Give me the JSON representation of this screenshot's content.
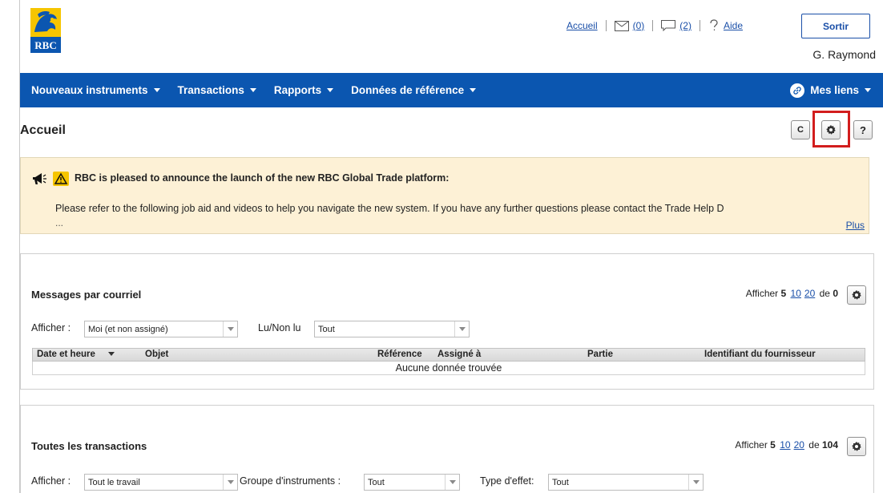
{
  "header": {
    "logo_text": "RBC",
    "links": {
      "home": "Accueil",
      "mail_count": "(0)",
      "chat_count": "(2)",
      "help": "Aide"
    },
    "logout_label": "Sortir",
    "user_name": "G. Raymond"
  },
  "nav": {
    "items": [
      {
        "label": "Nouveaux instruments"
      },
      {
        "label": "Transactions"
      },
      {
        "label": "Rapports"
      },
      {
        "label": "Données de référence"
      }
    ],
    "my_links": "Mes liens"
  },
  "page": {
    "title": "Accueil",
    "refresh_symbol": "C",
    "help_symbol": "?"
  },
  "announcement": {
    "title": "RBC is pleased to announce the launch of the new RBC Global Trade platform:",
    "body": "Please refer to the following job aid and videos to help you navigate the new system. If you have any further questions please contact the Trade Help D",
    "ellipsis": "...",
    "more_link": "Plus"
  },
  "email_panel": {
    "title": "Messages par courriel",
    "pager_prefix": "Afficher",
    "pager_current": "5",
    "pager_opt1": "10",
    "pager_opt2": "20",
    "pager_of": "de",
    "pager_total": "0",
    "filter_show_label": "Afficher :",
    "filter_show_value": "Moi (et non assigné)",
    "filter_read_label": "Lu/Non lu",
    "filter_read_value": "Tout",
    "columns": {
      "datetime": "Date et heure",
      "subject": "Objet",
      "reference": "Référence",
      "assigned": "Assigné à",
      "party": "Partie",
      "supplier_id": "Identifiant du fournisseur"
    },
    "empty_message": "Aucune donnée trouvée"
  },
  "transactions_panel": {
    "title": "Toutes les transactions",
    "pager_prefix": "Afficher",
    "pager_current": "5",
    "pager_opt1": "10",
    "pager_opt2": "20",
    "pager_of": "de",
    "pager_total": "104",
    "filter_show_label": "Afficher :",
    "filter_show_value": "Tout le travail",
    "filter_group_label": "Groupe d'instruments :",
    "filter_group_value": "Tout",
    "filter_type_label": "Type d'effet:",
    "filter_type_value": "Tout"
  },
  "colors": {
    "nav_bg": "#0b56b0",
    "link": "#1a4fa8",
    "announcement_bg": "#fdf1d6",
    "highlight": "#d21d1d"
  },
  "icons": [
    "rbc-lion-logo-icon",
    "mail-icon",
    "chat-icon",
    "help-icon",
    "link-icon",
    "refresh-icon",
    "gear-icon",
    "megaphone-icon",
    "warning-icon",
    "chevron-down-icon"
  ]
}
